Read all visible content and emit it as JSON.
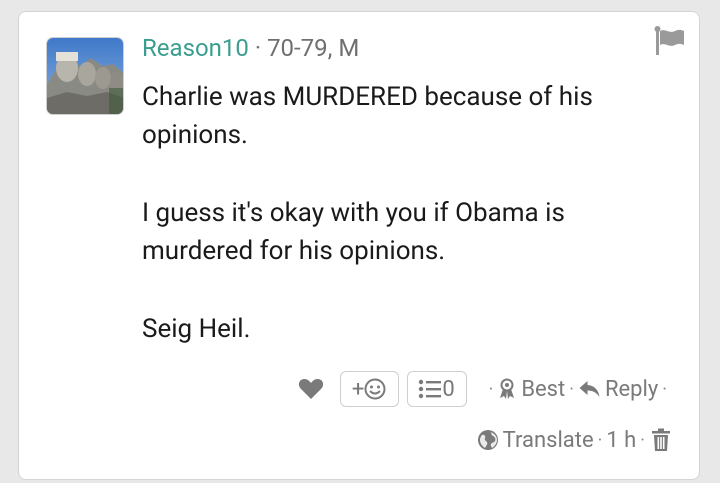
{
  "post": {
    "username": "Reason10",
    "separator": "·",
    "meta": "70-79, M",
    "paragraphs": [
      "Charlie was MURDERED because of his opinions.",
      "I guess it's okay with you if Obama is murdered for his opinions.",
      "Seig Heil."
    ]
  },
  "actions": {
    "react_plus": "+",
    "comment_count": "0",
    "best_label": "Best",
    "reply_label": "Reply",
    "dot": "·"
  },
  "footer": {
    "translate_label": "Translate",
    "time": "1 h",
    "dot": "·"
  },
  "colors": {
    "username": "#3a9d8f",
    "icon_gray": "#7a7a7a",
    "background": "#e8e8e8"
  },
  "icons": [
    "flag-icon",
    "heart-icon",
    "smiley-icon",
    "list-icon",
    "award-icon",
    "reply-arrow-icon",
    "globe-icon",
    "trash-icon"
  ]
}
